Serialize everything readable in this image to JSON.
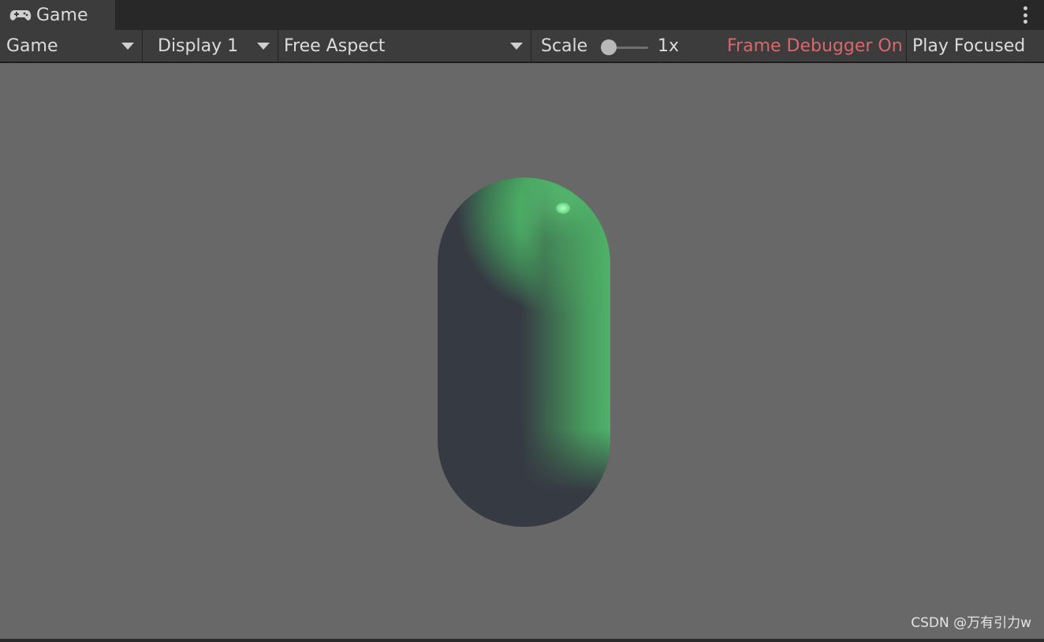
{
  "tab": {
    "label": "Game",
    "icon": "gamepad-icon"
  },
  "menu": {
    "icon": "kebab-menu-icon"
  },
  "toolbar": {
    "mode_dropdown": "Game",
    "display_dropdown": "Display 1",
    "aspect_dropdown": "Free Aspect",
    "scale_label": "Scale",
    "scale_value": "1x",
    "scale_slider_position": 0,
    "frame_debugger": "Frame Debugger On",
    "play_focused": "Play Focused"
  },
  "viewport": {
    "background_color": "#686868",
    "object": "capsule",
    "object_color": "#4fb269"
  },
  "watermark": "CSDN @万有引力w",
  "colors": {
    "frame_debugger_text": "#d9676b",
    "toolbar_bg": "#3c3c3c"
  }
}
